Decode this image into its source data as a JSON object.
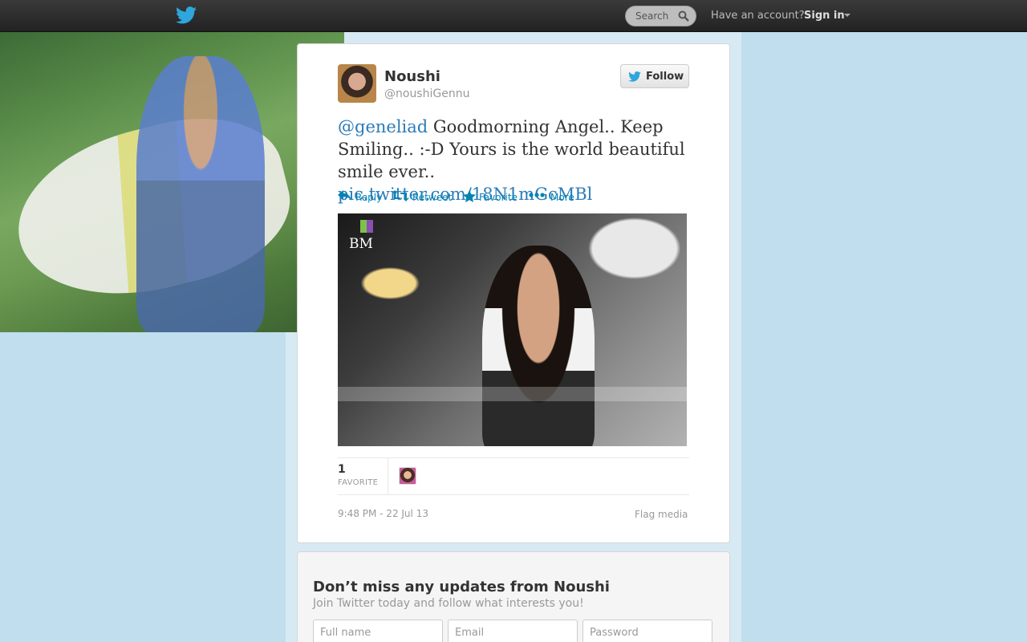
{
  "topbar": {
    "search_placeholder": "Search",
    "account_prompt": "Have an account?",
    "signin_label": "Sign in"
  },
  "tweet": {
    "author_name": "Noushi",
    "author_handle": "@noushiGennu",
    "follow_label": "Follow",
    "mention": "@geneliad",
    "text": " Goodmorning Angel.. Keep Smiling.. :-D Yours is the world beautiful smile ever.. ",
    "link": "pic.twitter.com/18N1mGcMBl",
    "actions": {
      "reply": "Reply",
      "retweet": "Retweet",
      "favorite": "Favorite",
      "more": "More"
    },
    "photo_logo": "BM",
    "favorite_count": "1",
    "favorite_label": "FAVORITE",
    "timestamp": "9:48 PM - 22 Jul 13",
    "flag_media": "Flag media"
  },
  "signup": {
    "title": "Don’t miss any updates from Noushi",
    "subtitle": "Join Twitter today and follow what interests you!",
    "fullname_placeholder": "Full name",
    "email_placeholder": "Email",
    "password_placeholder": "Password"
  },
  "colors": {
    "background": "#c0deed",
    "link": "#2b7bb9",
    "action": "#0084b4",
    "topbar": "#2b2b2b"
  }
}
